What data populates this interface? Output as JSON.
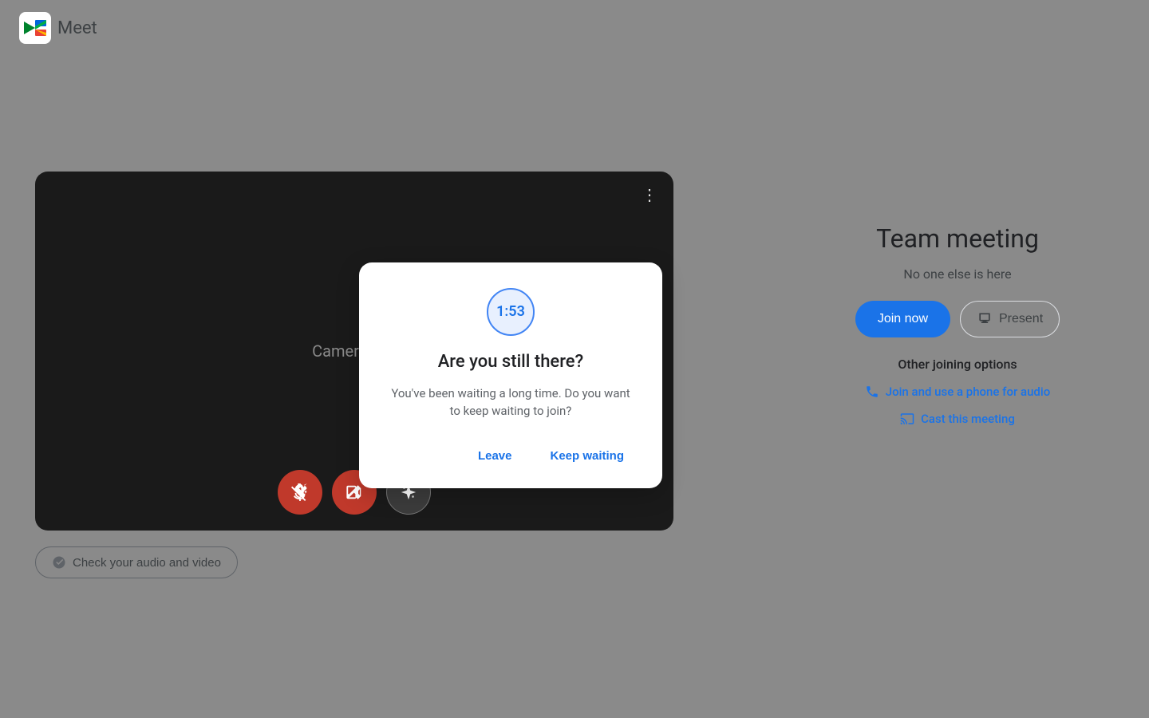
{
  "header": {
    "app_name": "Meet",
    "logo_icon_label": "google-meet-logo"
  },
  "video_preview": {
    "camera_off_text": "Camera is o",
    "three_dots_label": "⋮"
  },
  "controls": {
    "mic_label": "mute-microphone",
    "camera_label": "turn-off-camera",
    "effects_label": "visual-effects"
  },
  "check_audio": {
    "label": "Check your audio and video"
  },
  "right_panel": {
    "meeting_title": "Team meeting",
    "meeting_subtitle": "No one else is here",
    "join_now_label": "Join now",
    "present_label": "Present",
    "other_options_title": "Other joining options",
    "phone_audio_label": "Join and use a phone for audio",
    "cast_label": "Cast this meeting"
  },
  "modal": {
    "timer": "1:53",
    "title": "Are you still there?",
    "body": "You've been waiting a long time. Do you want to keep waiting to join?",
    "leave_label": "Leave",
    "keep_waiting_label": "Keep waiting"
  },
  "colors": {
    "accent_blue": "#1a73e8",
    "red_control": "#c0392b",
    "background": "#8a8a8a"
  }
}
